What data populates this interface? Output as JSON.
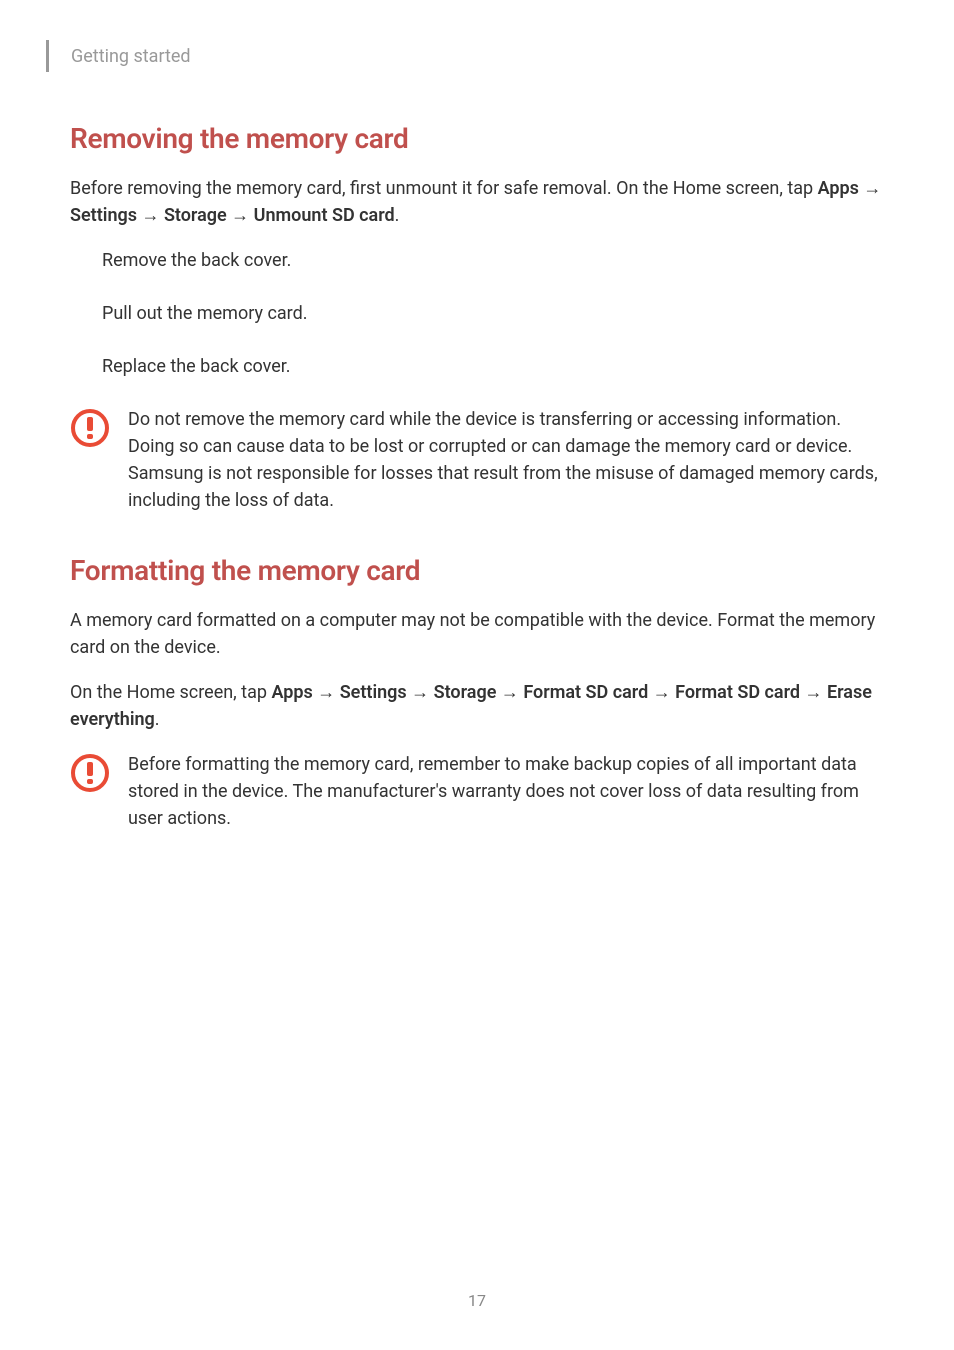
{
  "header": {
    "section_label": "Getting started"
  },
  "section1": {
    "heading": "Removing the memory card",
    "intro_part1": "Before removing the memory card, first unmount it for safe removal. On the Home screen, tap ",
    "path_apps": "Apps",
    "path_settings": "Settings",
    "path_storage": "Storage",
    "path_unmount": "Unmount SD card",
    "step1": "Remove the back cover.",
    "step2": "Pull out the memory card.",
    "step3": "Replace the back cover.",
    "caution": "Do not remove the memory card while the device is transferring or accessing information. Doing so can cause data to be lost or corrupted or can damage the memory card or device. Samsung is not responsible for losses that result from the misuse of damaged memory cards, including the loss of data."
  },
  "section2": {
    "heading": "Formatting the memory card",
    "para1": "A memory card formatted on a computer may not be compatible with the device. Format the memory card on the device.",
    "para2_part1": "On the Home screen, tap ",
    "path_apps": "Apps",
    "path_settings": "Settings",
    "path_storage": "Storage",
    "path_format1": "Format SD card",
    "path_format2": "Format SD card",
    "path_erase": "Erase everything",
    "caution": "Before formatting the memory card, remember to make backup copies of all important data stored in the device. The manufacturer's warranty does not cover loss of data resulting from user actions."
  },
  "page_number": "17",
  "arrow": "→"
}
